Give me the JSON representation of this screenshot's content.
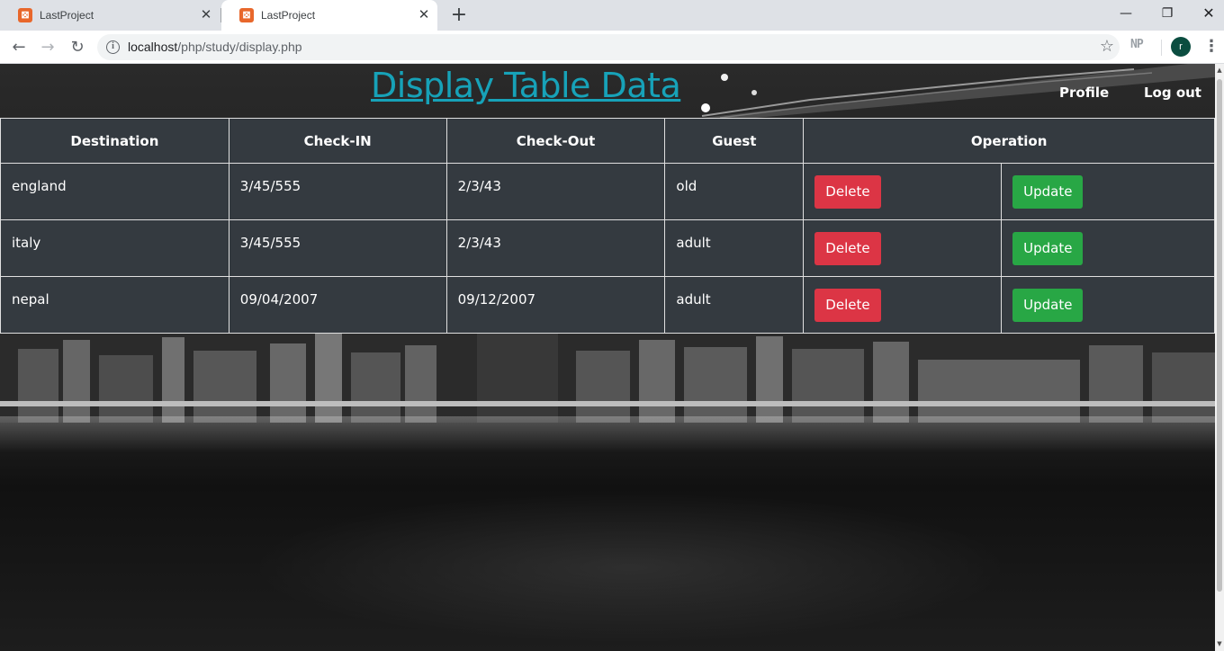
{
  "browser": {
    "tabs": [
      {
        "title": "LastProject",
        "active": false
      },
      {
        "title": "LastProject",
        "active": true
      }
    ],
    "url_host": "localhost",
    "url_path": "/php/study/display.php",
    "extension_label": "NP",
    "avatar_letter": "r"
  },
  "page": {
    "title": "Display Table Data",
    "title_color": "#17a2b8",
    "nav": {
      "profile": "Profile",
      "logout": "Log out"
    }
  },
  "table": {
    "headers": [
      "Destination",
      "Check-IN",
      "Check-Out",
      "Guest",
      "Operation"
    ],
    "rows": [
      {
        "destination": "england",
        "check_in": "3/45/555",
        "check_out": "2/3/43",
        "guest": "old"
      },
      {
        "destination": "italy",
        "check_in": "3/45/555",
        "check_out": "2/3/43",
        "guest": "adult"
      },
      {
        "destination": "nepal",
        "check_in": "09/04/2007",
        "check_out": "09/12/2007",
        "guest": "adult"
      }
    ],
    "delete_label": "Delete",
    "update_label": "Update",
    "colors": {
      "table_bg": "#343a40",
      "delete": "#dc3545",
      "update": "#28a745"
    }
  }
}
